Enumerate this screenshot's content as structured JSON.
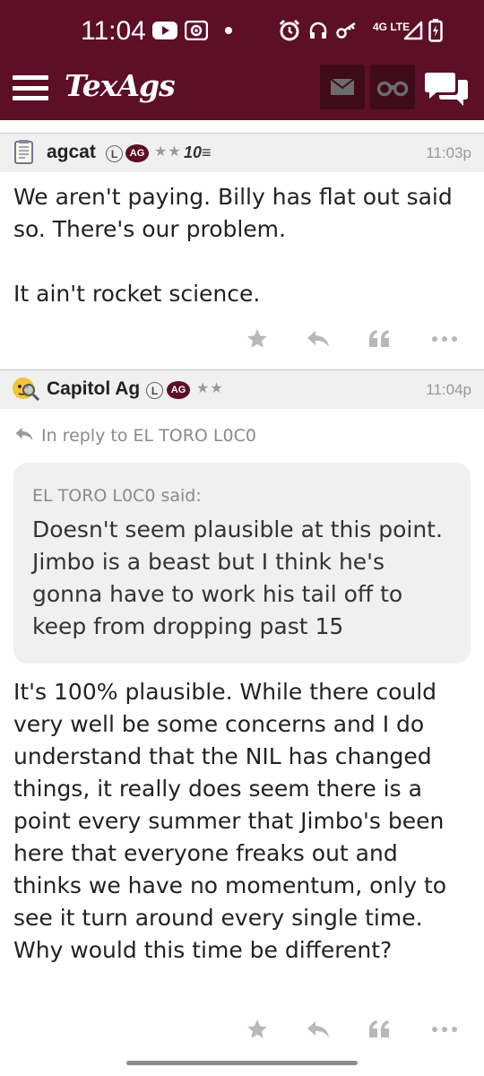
{
  "status_bar": {
    "time": "11:04",
    "network_label": "4G LTE",
    "icons": [
      "youtube-icon",
      "radio-icon",
      "notification-dot-icon",
      "alarm-icon",
      "headphones-icon",
      "key-icon",
      "signal-icon",
      "battery-charging-icon"
    ]
  },
  "app_bar": {
    "logo": "TexAgs",
    "icons": [
      "menu-icon",
      "mail-icon",
      "binoculars-icon",
      "chat-icon"
    ]
  },
  "posts": [
    {
      "username": "agcat",
      "badge_l": "L",
      "badge_ag": "AG",
      "stars": "★★",
      "rank": "10≡",
      "time": "11:03p",
      "paragraphs": [
        "We aren't paying. Billy has flat out said so. There's our problem.",
        "It ain't rocket science."
      ]
    },
    {
      "username": "Capitol Ag",
      "badge_l": "L",
      "badge_ag": "AG",
      "stars": "★★",
      "time": "11:04p",
      "reply_to": "In reply to EL TORO L0C0",
      "quote": {
        "author_said": "EL TORO L0C0 said:",
        "text": "Doesn't seem plausible at this point. Jimbo is a beast but I think he's gonna have to work his tail off to keep from dropping past 15"
      },
      "paragraphs": [
        "It's 100% plausible. While there could very well be some concerns and I do understand that the NIL has changed things, it really does seem there is a point every summer that Jimbo's been here that everyone freaks out and thinks we have no momentum, only to see it turn around every single time. Why would this time be different?"
      ]
    }
  ],
  "post_actions": [
    "star-icon",
    "reply-icon",
    "quote-icon",
    "more-icon"
  ],
  "colors": {
    "maroon": "#5c0f26",
    "dark_button": "#3f0a1a",
    "header_bg": "#f0f0f0",
    "muted_text": "#999999"
  }
}
